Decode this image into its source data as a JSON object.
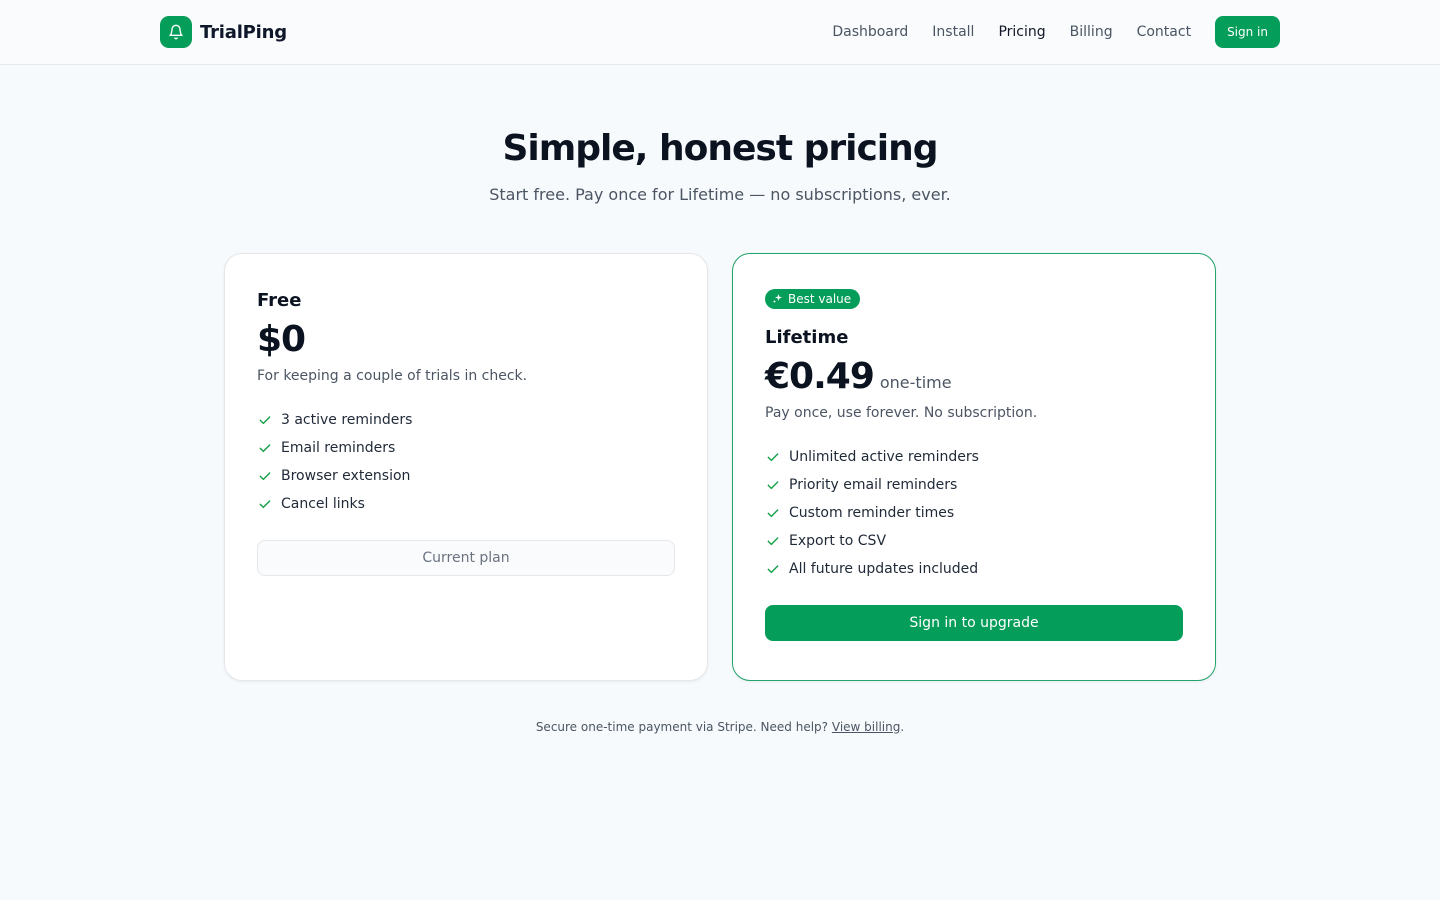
{
  "brand": {
    "name": "TrialPing",
    "logo_icon": "bell-icon",
    "color": "#059d5a"
  },
  "nav": {
    "items": [
      {
        "label": "Dashboard",
        "active": false
      },
      {
        "label": "Install",
        "active": false
      },
      {
        "label": "Pricing",
        "active": true
      },
      {
        "label": "Billing",
        "active": false
      },
      {
        "label": "Contact",
        "active": false
      }
    ],
    "signin_label": "Sign in"
  },
  "hero": {
    "title": "Simple, honest pricing",
    "subtitle": "Start free. Pay once for Lifetime — no subscriptions, ever."
  },
  "plans": {
    "free": {
      "name": "Free",
      "price": "$0",
      "description": "For keeping a couple of trials in check.",
      "features": [
        "3 active reminders",
        "Email reminders",
        "Browser extension",
        "Cancel links"
      ],
      "button_label": "Current plan"
    },
    "lifetime": {
      "badge": "Best value",
      "badge_icon": "sparkles-icon",
      "name": "Lifetime",
      "price": "€0.49",
      "price_suffix": "one-time",
      "description": "Pay once, use forever. No subscription.",
      "features": [
        "Unlimited active reminders",
        "Priority email reminders",
        "Custom reminder times",
        "Export to CSV",
        "All future updates included"
      ],
      "button_label": "Sign in to upgrade"
    }
  },
  "footnote": {
    "text": "Secure one-time payment via Stripe. Need help?",
    "link_label": "View billing",
    "end": "."
  },
  "colors": {
    "accent": "#059d5a",
    "check": "#16a34a"
  }
}
